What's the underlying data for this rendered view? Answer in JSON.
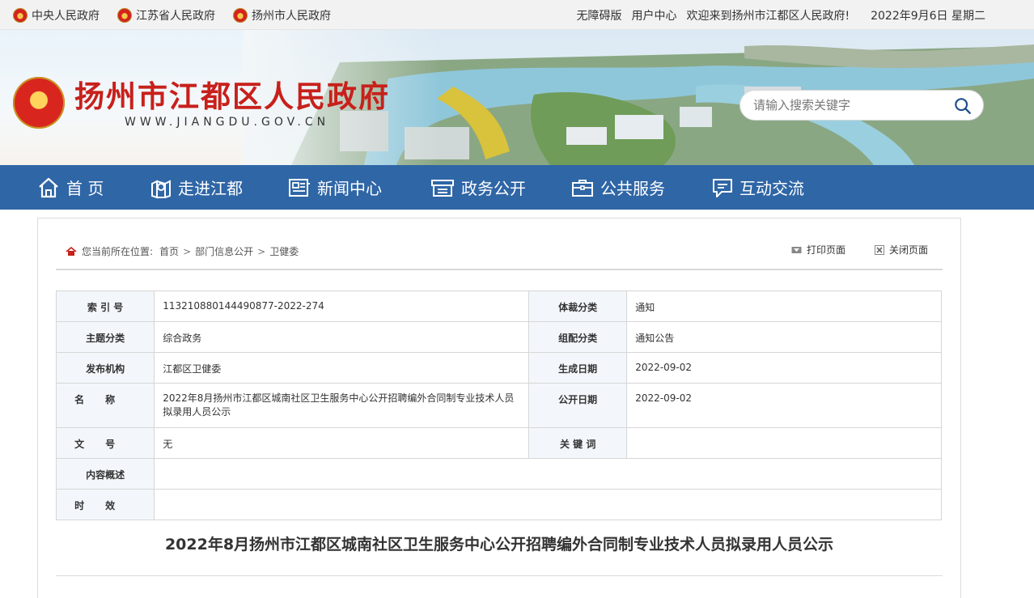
{
  "topbar": {
    "links": [
      "中央人民政府",
      "江苏省人民政府",
      "扬州市人民政府"
    ],
    "accessibility": "无障碍版",
    "user_center": "用户中心",
    "welcome": "欢迎来到扬州市江都区人民政府!",
    "date": "2022年9月6日 星期二"
  },
  "header": {
    "title": "扬州市江都区人民政府",
    "url": "WWW.JIANGDU.GOV.CN",
    "search_placeholder": "请输入搜索关键字"
  },
  "nav": {
    "items": [
      "首 页",
      "走进江都",
      "新闻中心",
      "政务公开",
      "公共服务",
      "互动交流"
    ]
  },
  "breadcrumb": {
    "label": "您当前所在位置:",
    "items": [
      "首页",
      "部门信息公开",
      "卫健委"
    ]
  },
  "tools": {
    "print": "打印页面",
    "close": "关闭页面"
  },
  "meta": {
    "index_no_label": "索 引 号",
    "index_no": "113210880144490877-2022-274",
    "genre_label": "体裁分类",
    "genre": "通知",
    "topic_label": "主题分类",
    "topic": "综合政务",
    "group_label": "组配分类",
    "group": "通知公告",
    "publisher_label": "发布机构",
    "publisher": "江都区卫健委",
    "created_label": "生成日期",
    "created": "2022-09-02",
    "name_label": "名称",
    "name": "2022年8月扬州市江都区城南社区卫生服务中心公开招聘编外合同制专业技术人员拟录用人员公示",
    "published_label": "公开日期",
    "published": "2022-09-02",
    "doc_no_label": "文号",
    "doc_no": "无",
    "keywords_label": "关 键 词",
    "keywords": "",
    "summary_label": "内容概述",
    "summary": "",
    "validity_label": "时效",
    "validity": ""
  },
  "article": {
    "title": "2022年8月扬州市江都区城南社区卫生服务中心公开招聘编外合同制专业技术人员拟录用人员公示"
  },
  "colors": {
    "nav_bg": "#2f66a6",
    "title_red": "#c8201b",
    "label_bg": "#f3f7fb"
  }
}
